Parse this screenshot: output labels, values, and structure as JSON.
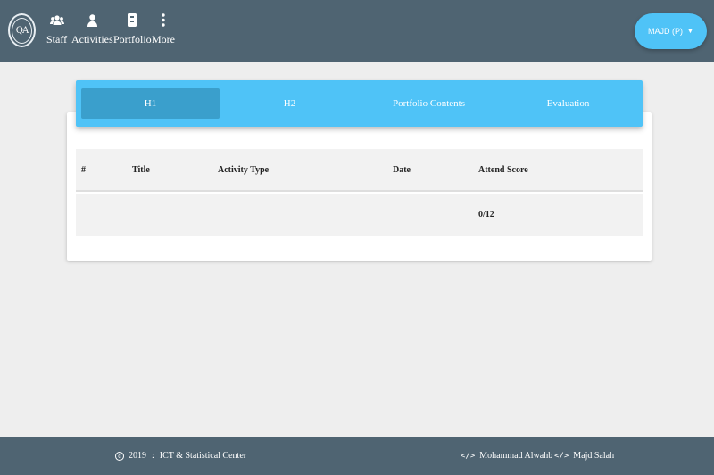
{
  "navbar": {
    "logo_text": "QA",
    "items": [
      {
        "label": "Staff",
        "icon": "users-icon"
      },
      {
        "label": "Activities",
        "icon": "user-icon"
      },
      {
        "label": "Portfolio",
        "icon": "portfolio-icon"
      },
      {
        "label": "More",
        "icon": "more-vertical-icon"
      }
    ],
    "user_label": "MAJD (P)"
  },
  "tabs": [
    {
      "label": "H1",
      "active": true
    },
    {
      "label": "H2",
      "active": false
    },
    {
      "label": "Portfolio Contents",
      "active": false
    },
    {
      "label": "Evaluation",
      "active": false
    }
  ],
  "table": {
    "headers": [
      "#",
      "Title",
      "Activity Type",
      "Date",
      "Attend Score"
    ],
    "rows": [
      [
        "",
        "",
        "",
        "",
        "0/12"
      ]
    ]
  },
  "footer": {
    "copyright_year": "2019",
    "separator": ":",
    "org": "ICT & Statistical Center",
    "credits": [
      "Mohammad Alwahb",
      "Majd Salah"
    ]
  },
  "colors": {
    "navbar": "#4f6472",
    "accent": "#4fc3f7",
    "active_tab": "#3a9fcc",
    "background": "#eeeeee"
  }
}
